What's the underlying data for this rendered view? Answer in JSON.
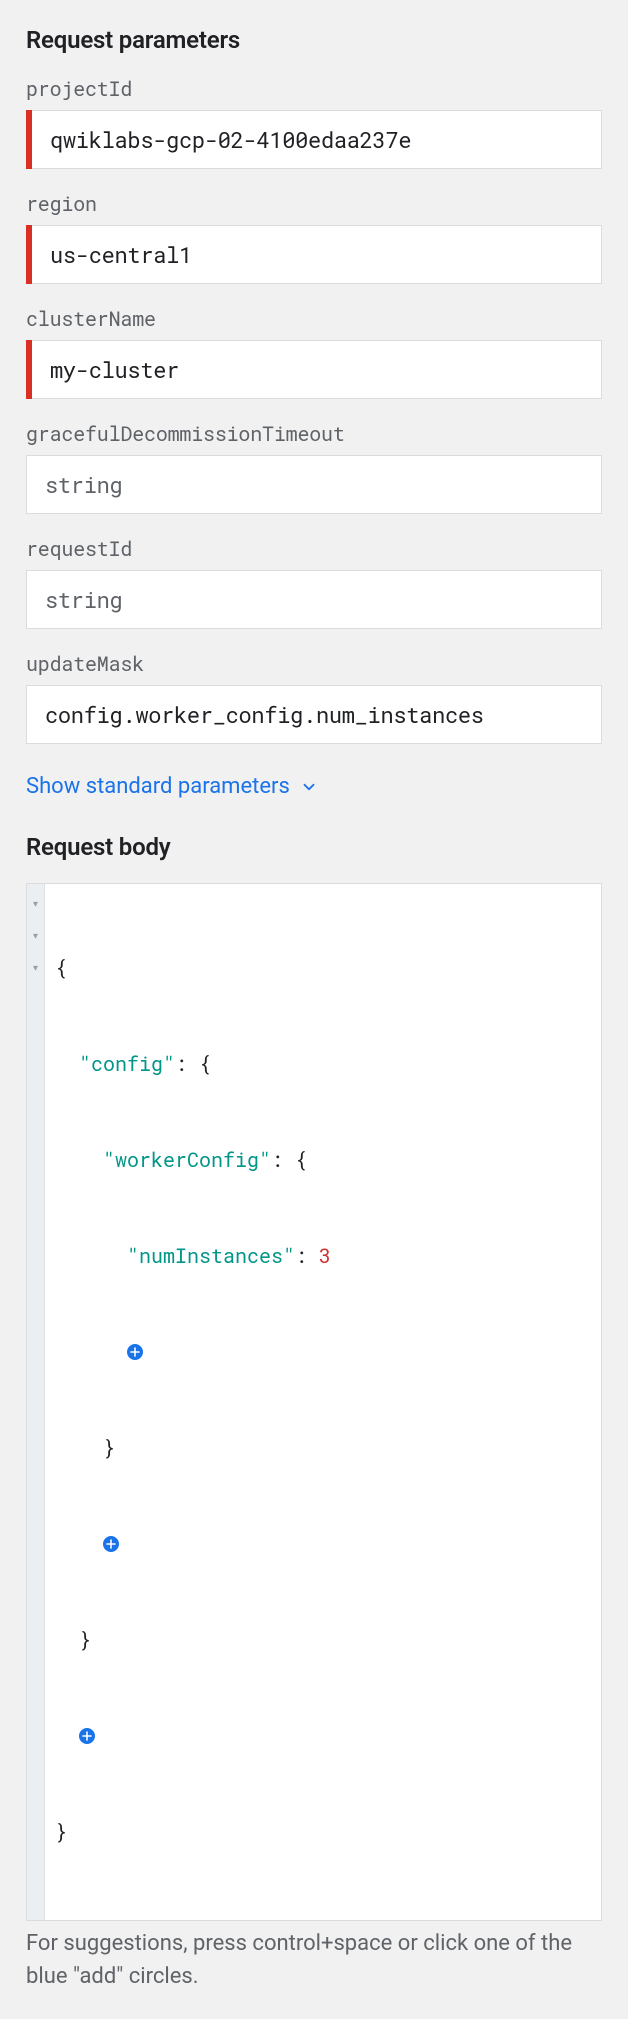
{
  "headings": {
    "request_parameters": "Request parameters",
    "request_body": "Request body"
  },
  "params": {
    "projectId": {
      "label": "projectId",
      "value": "qwiklabs-gcp-02-4100edaa237e",
      "required": true
    },
    "region": {
      "label": "region",
      "value": "us-central1",
      "required": true
    },
    "clusterName": {
      "label": "clusterName",
      "value": "my-cluster",
      "required": true
    },
    "gracefulDecommissionTimeout": {
      "label": "gracefulDecommissionTimeout",
      "value": "",
      "placeholder": "string",
      "required": false
    },
    "requestId": {
      "label": "requestId",
      "value": "",
      "placeholder": "string",
      "required": false
    },
    "updateMask": {
      "label": "updateMask",
      "value": "config.worker_config.num_instances",
      "required": false
    }
  },
  "show_std_params": "Show standard parameters",
  "body": {
    "keys": {
      "config": "\"config\"",
      "workerConfig": "\"workerConfig\"",
      "numInstances": "\"numInstances\""
    },
    "numInstancesValue": "3",
    "data": {
      "config": {
        "workerConfig": {
          "numInstances": 3
        }
      }
    }
  },
  "hint": "For suggestions, press control+space or click one of the blue \"add\" circles."
}
